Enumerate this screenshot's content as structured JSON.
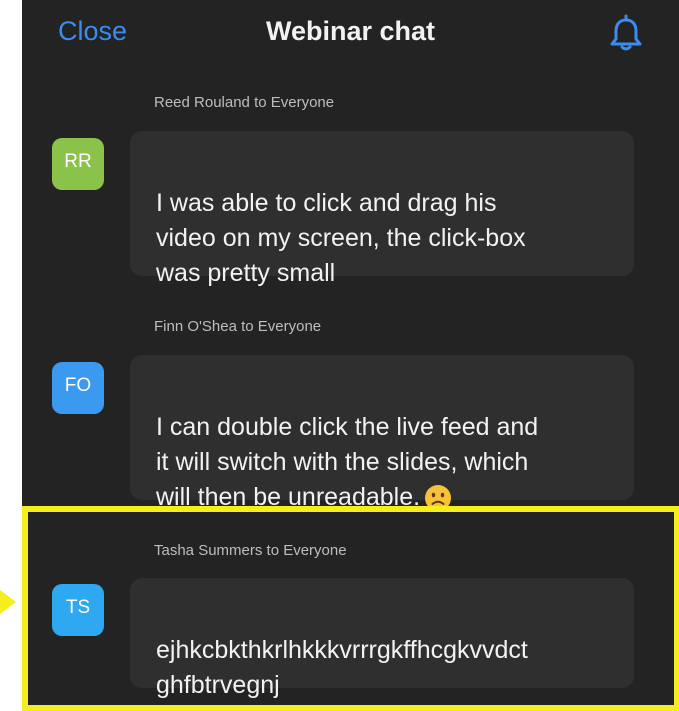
{
  "header": {
    "close_label": "Close",
    "title": "Webinar chat",
    "bell_icon": "bell-icon"
  },
  "colors": {
    "accent": "#3b8cf0",
    "background": "#232323",
    "bubble": "#2f2f2f",
    "highlight": "#f4ef1c"
  },
  "messages": [
    {
      "sender": "Reed Rouland to Everyone",
      "initials": "RR",
      "avatar_color": "#8bc34a",
      "text": "I was able to click and drag his\nvideo on my screen, the click-box\nwas pretty small"
    },
    {
      "sender": "Finn O'Shea to Everyone",
      "initials": "FO",
      "avatar_color": "#3b9af0",
      "text": "I can double click the live feed and\nit will switch with the slides, which\nwill then be unreadable.",
      "emoji": "slightly-frowning-face-icon"
    },
    {
      "sender": "Tasha Summers to Everyone",
      "initials": "TS",
      "avatar_color": "#2ea8f0",
      "text": "ejhkcbkthkrlhkkkvrrrgkffhcgkvvdct\nghfbtrvegnj"
    }
  ]
}
